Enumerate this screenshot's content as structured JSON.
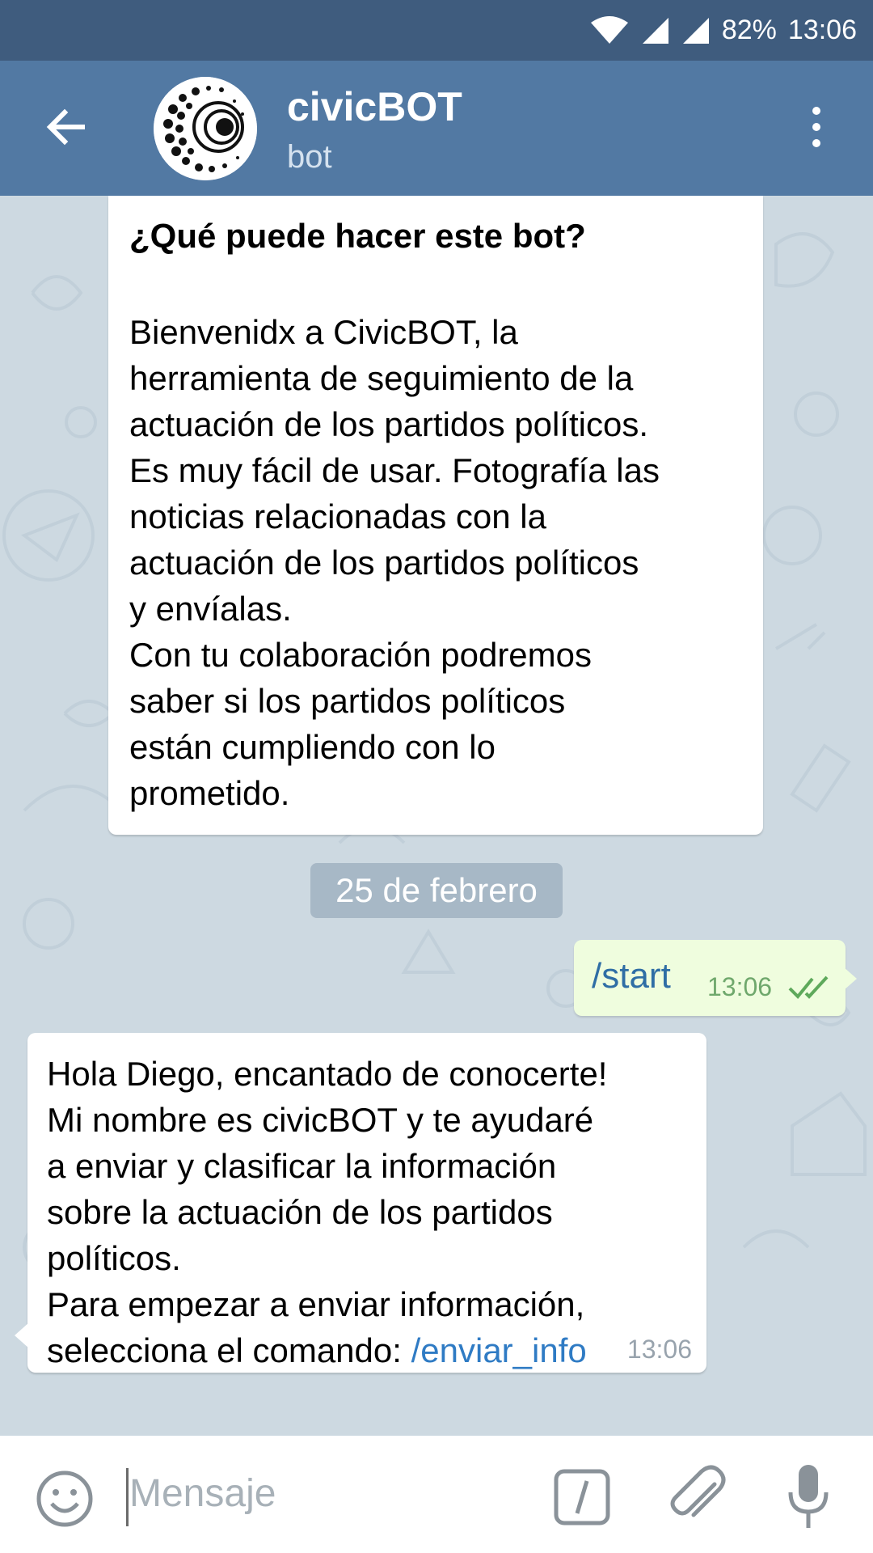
{
  "status_bar": {
    "battery": "82%",
    "time": "13:06"
  },
  "header": {
    "title": "civicBOT",
    "subtitle": "bot"
  },
  "intro": {
    "title": "¿Qué puede hacer este bot?",
    "body": "Bienvenidx a CivicBOT, la\nherramienta de seguimiento de la\nactuación de los partidos políticos.\nEs muy fácil de usar. Fotografía las\nnoticias relacionadas con la\nactuación de los partidos políticos\ny envíalas.\nCon tu colaboración podremos\nsaber si los partidos políticos\nestán cumpliendo con lo\nprometido."
  },
  "date_separator": "25 de febrero",
  "outgoing": {
    "text": "/start",
    "time": "13:06"
  },
  "incoming": {
    "text": "Hola Diego, encantado de conocerte!\nMi nombre es civicBOT y te ayudaré\na enviar y clasificar la información\nsobre la actuación de los partidos\npolíticos.\nPara empezar a enviar información,\nselecciona el comando: ",
    "link": "/enviar_info",
    "time": "13:06"
  },
  "input": {
    "placeholder": "Mensaje"
  },
  "icons": {
    "back": "back-arrow-icon",
    "menu": "more-vertical-icon",
    "wifi": "wifi-icon",
    "signal": "signal-icon",
    "emoji": "emoji-icon",
    "command": "slash-command-icon",
    "attach": "paperclip-icon",
    "mic": "microphone-icon"
  },
  "colors": {
    "status_bar": "#3f5c7e",
    "app_bar": "#5279a3",
    "outgoing_bubble": "#effdde",
    "link": "#2f7bc4"
  }
}
